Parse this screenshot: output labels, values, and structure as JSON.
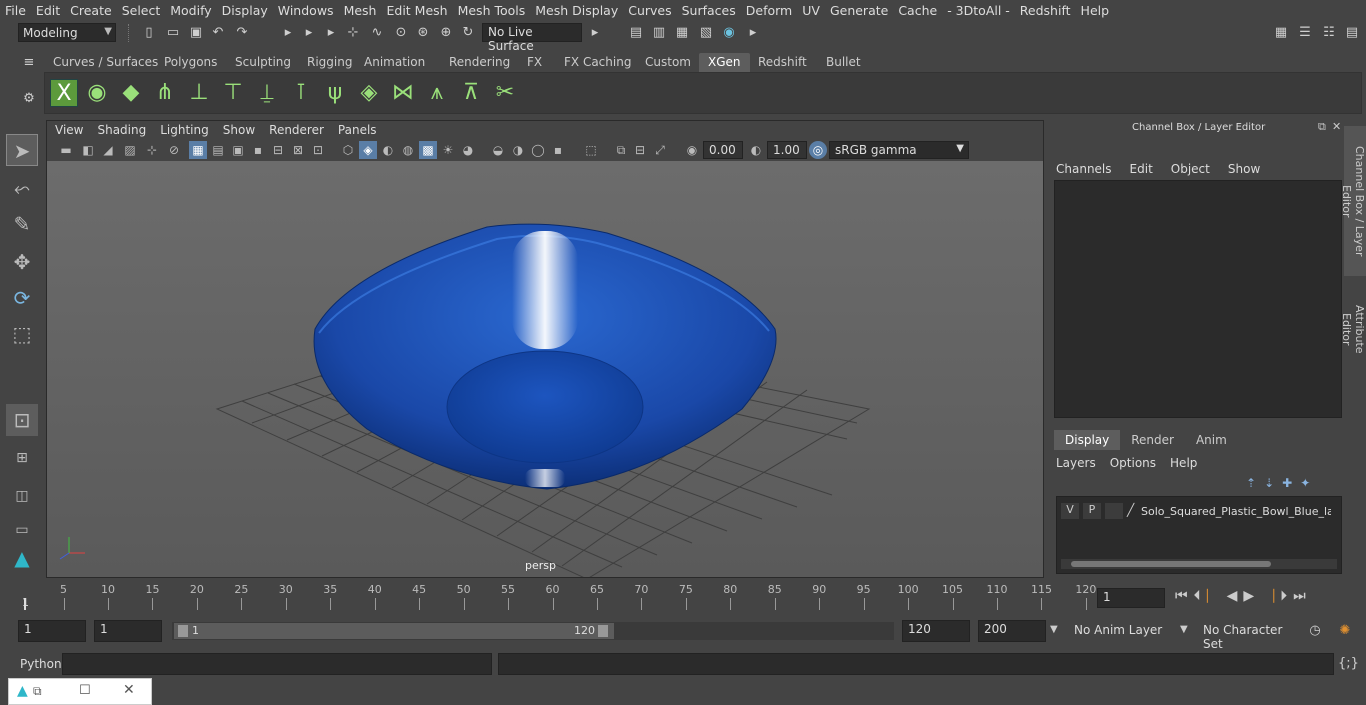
{
  "menu": [
    "File",
    "Edit",
    "Create",
    "Select",
    "Modify",
    "Display",
    "Windows",
    "Mesh",
    "Edit Mesh",
    "Mesh Tools",
    "Mesh Display",
    "Curves",
    "Surfaces",
    "Deform",
    "UV",
    "Generate",
    "Cache",
    "- 3DtoAll -",
    "Redshift",
    "Help"
  ],
  "status": {
    "mode": "Modeling",
    "live_surface": "No Live Surface"
  },
  "shelf_tabs": [
    "Curves / Surfaces",
    "Polygons",
    "Sculpting",
    "Rigging",
    "Animation",
    "Rendering",
    "FX",
    "FX Caching",
    "Custom",
    "XGen",
    "Redshift",
    "Bullet"
  ],
  "active_shelf": "XGen",
  "viewport": {
    "menu": [
      "View",
      "Shading",
      "Lighting",
      "Show",
      "Renderer",
      "Panels"
    ],
    "exposure": "0.00",
    "gamma": "1.00",
    "colorspace": "sRGB gamma",
    "camera": "persp"
  },
  "channel_box": {
    "title": "Channel Box / Layer Editor",
    "menu": [
      "Channels",
      "Edit",
      "Object",
      "Show"
    ],
    "tabs": [
      "Display",
      "Render",
      "Anim"
    ],
    "layer_menu": [
      "Layers",
      "Options",
      "Help"
    ],
    "layer": {
      "v": "V",
      "p": "P",
      "name": "Solo_Squared_Plastic_Bowl_Blue_laye"
    }
  },
  "side_tabs": [
    "Channel Box / Layer Editor",
    "Attribute Editor"
  ],
  "timeline": {
    "ticks": [
      "5",
      "10",
      "15",
      "20",
      "25",
      "30",
      "35",
      "40",
      "45",
      "50",
      "55",
      "60",
      "65",
      "70",
      "75",
      "80",
      "85",
      "90",
      "95",
      "100",
      "105",
      "110",
      "115",
      "120"
    ],
    "start_label": "1",
    "current_frame": "1"
  },
  "range": {
    "start": "1",
    "start2": "1",
    "slider_start": "1",
    "slider_end": "120",
    "end": "120",
    "end2": "200",
    "anim_layer": "No Anim Layer",
    "char_set": "No Character Set"
  },
  "cmd": {
    "label": "Python"
  },
  "colors": {
    "bowl": "#1a4fb0",
    "grid": "#3f3f3f",
    "accent": "#5a7ea6"
  }
}
